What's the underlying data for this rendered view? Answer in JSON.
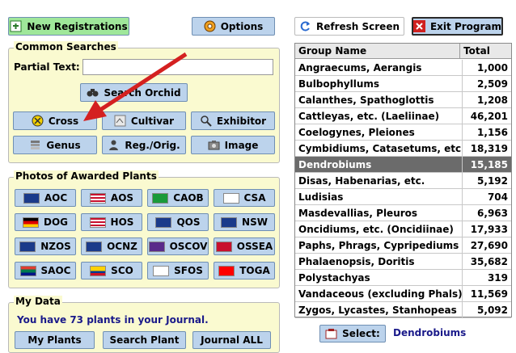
{
  "toolbar": {
    "new_registrations": "New Registrations",
    "options": "Options",
    "refresh_screen": "Refresh Screen",
    "exit_program": "Exit Program"
  },
  "common_searches": {
    "title": "Common Searches",
    "partial_text_label": "Partial Text:",
    "partial_text_value": "",
    "search_orchid": "Search Orchid",
    "buttons": [
      "Cross",
      "Cultivar",
      "Exhibitor",
      "Genus",
      "Reg./Orig.",
      "Image"
    ]
  },
  "awarded": {
    "title": "Photos of Awarded Plants",
    "buttons": [
      "AOC",
      "AOS",
      "CAOB",
      "CSA",
      "DOG",
      "HOS",
      "QOS",
      "NSW",
      "NZOS",
      "OCNZ",
      "OSCOV",
      "OSSEA",
      "SAOC",
      "SCO",
      "SFOS",
      "TOGA"
    ]
  },
  "my_data": {
    "title": "My Data",
    "journal_text": "You have 73 plants in your Journal.",
    "my_plants": "My Plants",
    "search_plant": "Search Plant",
    "journal_all": "Journal ALL"
  },
  "table": {
    "headers": [
      "Group Name",
      "Total"
    ],
    "rows": [
      [
        "Angraecums, Aerangis",
        "1,000"
      ],
      [
        "Bulbophyllums",
        "2,509"
      ],
      [
        "Calanthes, Spathoglottis",
        "1,208"
      ],
      [
        "Cattleyas, etc. (Laeliinae)",
        "46,201"
      ],
      [
        "Coelogynes, Pleiones",
        "1,156"
      ],
      [
        "Cymbidiums, Catasetums, etc.",
        "18,319"
      ],
      [
        "Dendrobiums",
        "15,185"
      ],
      [
        "Disas, Habenarias, etc.",
        "5,192"
      ],
      [
        "Ludisias",
        "704"
      ],
      [
        "Masdevallias, Pleuros",
        "6,963"
      ],
      [
        "Oncidiums, etc. (Oncidiinae)",
        "17,933"
      ],
      [
        "Paphs, Phrags, Cypripediums",
        "27,690"
      ],
      [
        "Phalaenopsis, Doritis",
        "35,682"
      ],
      [
        "Polystachyas",
        "319"
      ],
      [
        "Vandaceous (excluding Phals)",
        "11,569"
      ],
      [
        "Zygos, Lycastes, Stanhopeas",
        "5,092"
      ]
    ],
    "selected_index": 6
  },
  "select": {
    "label": "Select:",
    "value": "Dendrobiums"
  },
  "colors": {
    "button_bg": "#bcd3ec",
    "panel_bg": "#fafad0",
    "selected_row": "#6b6b6b",
    "arrow": "#d42020",
    "link_text": "#1a1a8a"
  }
}
